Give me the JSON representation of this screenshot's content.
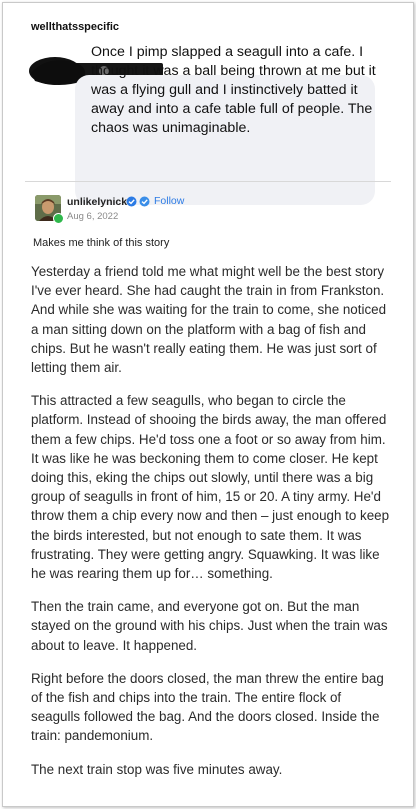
{
  "original_post": {
    "username": "wellthatsspecific",
    "quote_text": "Once I pimp slapped a seagull into a cafe. I thought it was a ball being thrown at me but it was a flying gull and I instinctively batted it away and into a cafe table full of people. The chaos was unimaginable."
  },
  "reblog": {
    "username": "unlikelynick",
    "follow_label": "Follow",
    "date": "Aug 6, 2022",
    "comment": "Makes me think of this story",
    "colors": {
      "follow": "#2c7be5",
      "badge": "#2c7be5",
      "online": "#2fb84c"
    },
    "icons": [
      "avatar",
      "verified-badge-icon",
      "verified-badge-icon"
    ],
    "paragraphs": [
      "Yesterday a friend told me what might well be the best story I've ever heard. She had caught the train in from Frankston. And while she was waiting for the train to come, she noticed a man sitting down on the platform with a bag of fish and chips. But he wasn't really eating them. He was just sort of letting them air.",
      "This attracted a few seagulls, who began to circle the platform. Instead of shooing the birds away, the man offered them a few chips. He'd toss one a foot or so away from him. It was like he was beckoning them to come closer. He kept doing this, eking the chips out slowly, until there was a big group of seagulls in front of him, 15 or 20. A tiny army. He'd throw them a chip every now and then – just enough to keep the birds interested, but not enough to sate them. It was frustrating. They were getting angry. Squawking. It was like he was rearing them up for… something.",
      "Then the train came, and everyone got on. But the man stayed on the ground with his chips. Just when the train was about to leave. It happened.",
      "Right before the doors closed, the man threw the entire bag of the fish and chips into the train. The entire flock of seagulls followed the bag. And the doors closed. Inside the train: pandemonium.",
      "The next train stop was five minutes away."
    ]
  }
}
